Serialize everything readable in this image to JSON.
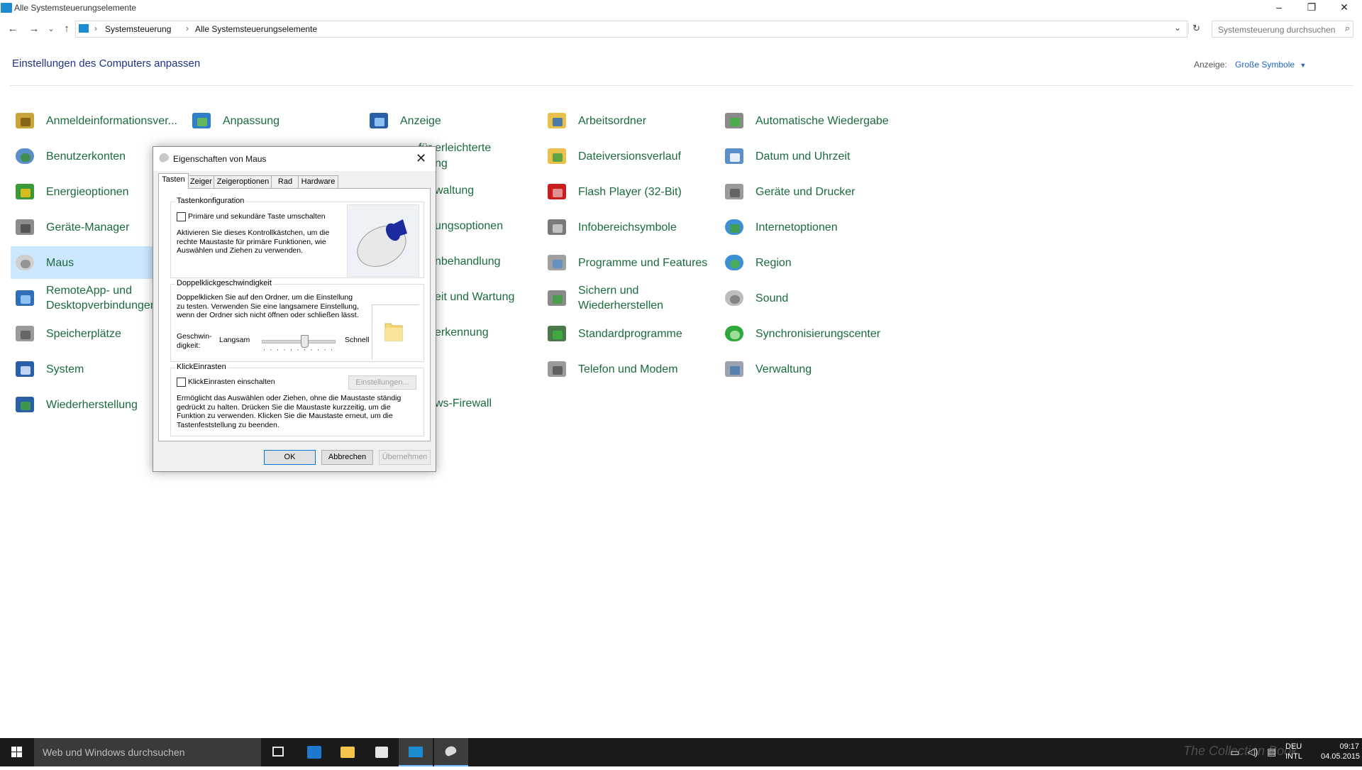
{
  "window": {
    "title": "Alle Systemsteuerungselemente",
    "controls": {
      "minimize": "–",
      "restore": "❐",
      "close": "✕"
    }
  },
  "nav": {
    "back": "←",
    "forward": "→",
    "recent": "⌄",
    "up": "↑",
    "refresh": "↻",
    "dropdown": "⌄"
  },
  "breadcrumb": [
    "Systemsteuerung",
    "Alle Systemsteuerungselemente"
  ],
  "search": {
    "placeholder": "Systemsteuerung durchsuchen"
  },
  "header": {
    "title": "Einstellungen des Computers anpassen",
    "view_label": "Anzeige:",
    "view_value": "Große Symbole"
  },
  "items": {
    "col1": [
      "Anmeldeinformationsver...",
      "Benutzerkonten",
      "Energieoptionen",
      "Geräte-Manager",
      "Maus",
      "RemoteApp- und Desktopverbindungen",
      "Speicherplätze",
      "System",
      "Wiederherstellung"
    ],
    "col2": [
      "Anpassung"
    ],
    "col3": [
      "Anzeige",
      "für erleichterte",
      "ng",
      "waltung",
      "ungsoptionen",
      "nbehandlung",
      "eit und Wartung",
      "erkennung",
      "ws-Firewall"
    ],
    "col4": [
      "Arbeitsordner",
      "Dateiversionsverlauf",
      "Flash Player (32-Bit)",
      "Infobereichsymbole",
      "Programme und Features",
      "Sichern und Wiederherstellen",
      "Standardprogramme",
      "Telefon und Modem"
    ],
    "col5": [
      "Automatische Wiedergabe",
      "Datum und Uhrzeit",
      "Geräte und Drucker",
      "Internetoptionen",
      "Region",
      "Sound",
      "Synchronisierungscenter",
      "Verwaltung"
    ]
  },
  "dialog": {
    "title": "Eigenschaften von Maus",
    "close": "✕",
    "tabs": [
      "Tasten",
      "Zeiger",
      "Zeigeroptionen",
      "Rad",
      "Hardware"
    ],
    "button_config": {
      "legend": "Tastenkonfiguration",
      "checkbox": "Primäre und sekundäre Taste umschalten",
      "description": "Aktivieren Sie dieses Kontrollkästchen, um die rechte Maustaste für primäre Funktionen, wie Auswählen und Ziehen zu verwenden."
    },
    "double_click": {
      "legend": "Doppelklickgeschwindigkeit",
      "description": "Doppelklicken Sie auf den Ordner, um die Einstellung zu testen. Verwenden Sie eine langsamere Einstellung, wenn der Ordner sich nicht öffnen oder schließen lässt.",
      "speed_label": "Geschwin-digkeit:",
      "slow": "Langsam",
      "fast": "Schnell",
      "speed_value": 0.6
    },
    "click_lock": {
      "legend": "KlickEinrasten",
      "checkbox": "KlickEinrasten einschalten",
      "settings_button": "Einstellungen...",
      "description": "Ermöglicht das Auswählen oder Ziehen, ohne die Maustaste ständig gedrückt zu halten. Drücken Sie die Maustaste kurzzeitig, um die Funktion zu verwenden. Klicken Sie die Maustaste erneut, um die Tastenfeststellung zu beenden."
    },
    "buttons": {
      "ok": "OK",
      "cancel": "Abbrechen",
      "apply": "Übernehmen"
    }
  },
  "taskbar": {
    "search_placeholder": "Web und Windows durchsuchen",
    "watermark": "The Collection Book",
    "lang_top": "DEU",
    "lang_bottom": "INTL",
    "time": "09:17",
    "date": "04.05.2015"
  },
  "colors": {
    "accent": "#1e3287",
    "link": "#1a6b3c",
    "selection": "#cce8ff",
    "taskbar": "#1a1a1a"
  }
}
